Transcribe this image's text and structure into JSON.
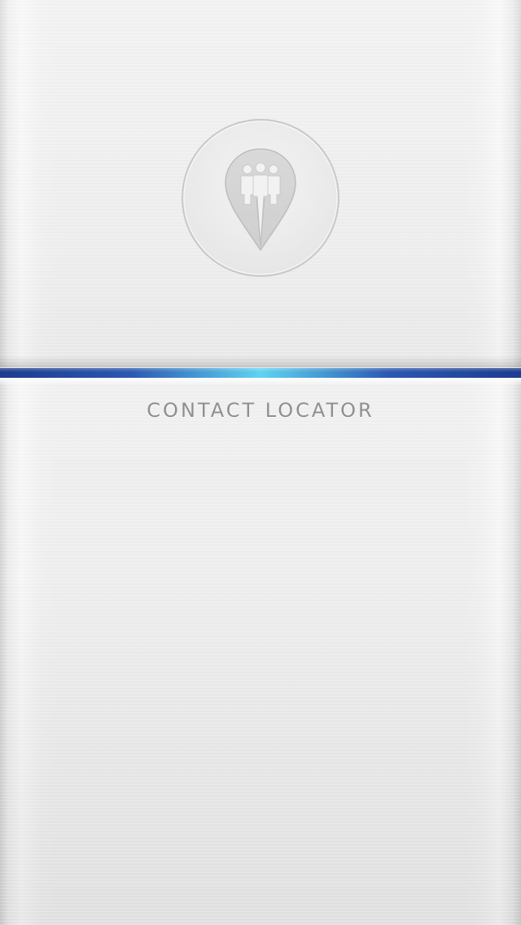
{
  "app": {
    "title": "CONTACT LOCATOR",
    "logo_icon": "contact-pin-icon"
  },
  "colors": {
    "background": "#eeeeee",
    "accent_bar_dark": "#1d3c8e",
    "accent_bar_mid": "#2b58b0",
    "accent_bar_glow": "#5fd3f2",
    "title_text": "#8f8f8f",
    "logo_stroke": "#c8c8c8",
    "logo_fill": "#d6d6d6"
  }
}
